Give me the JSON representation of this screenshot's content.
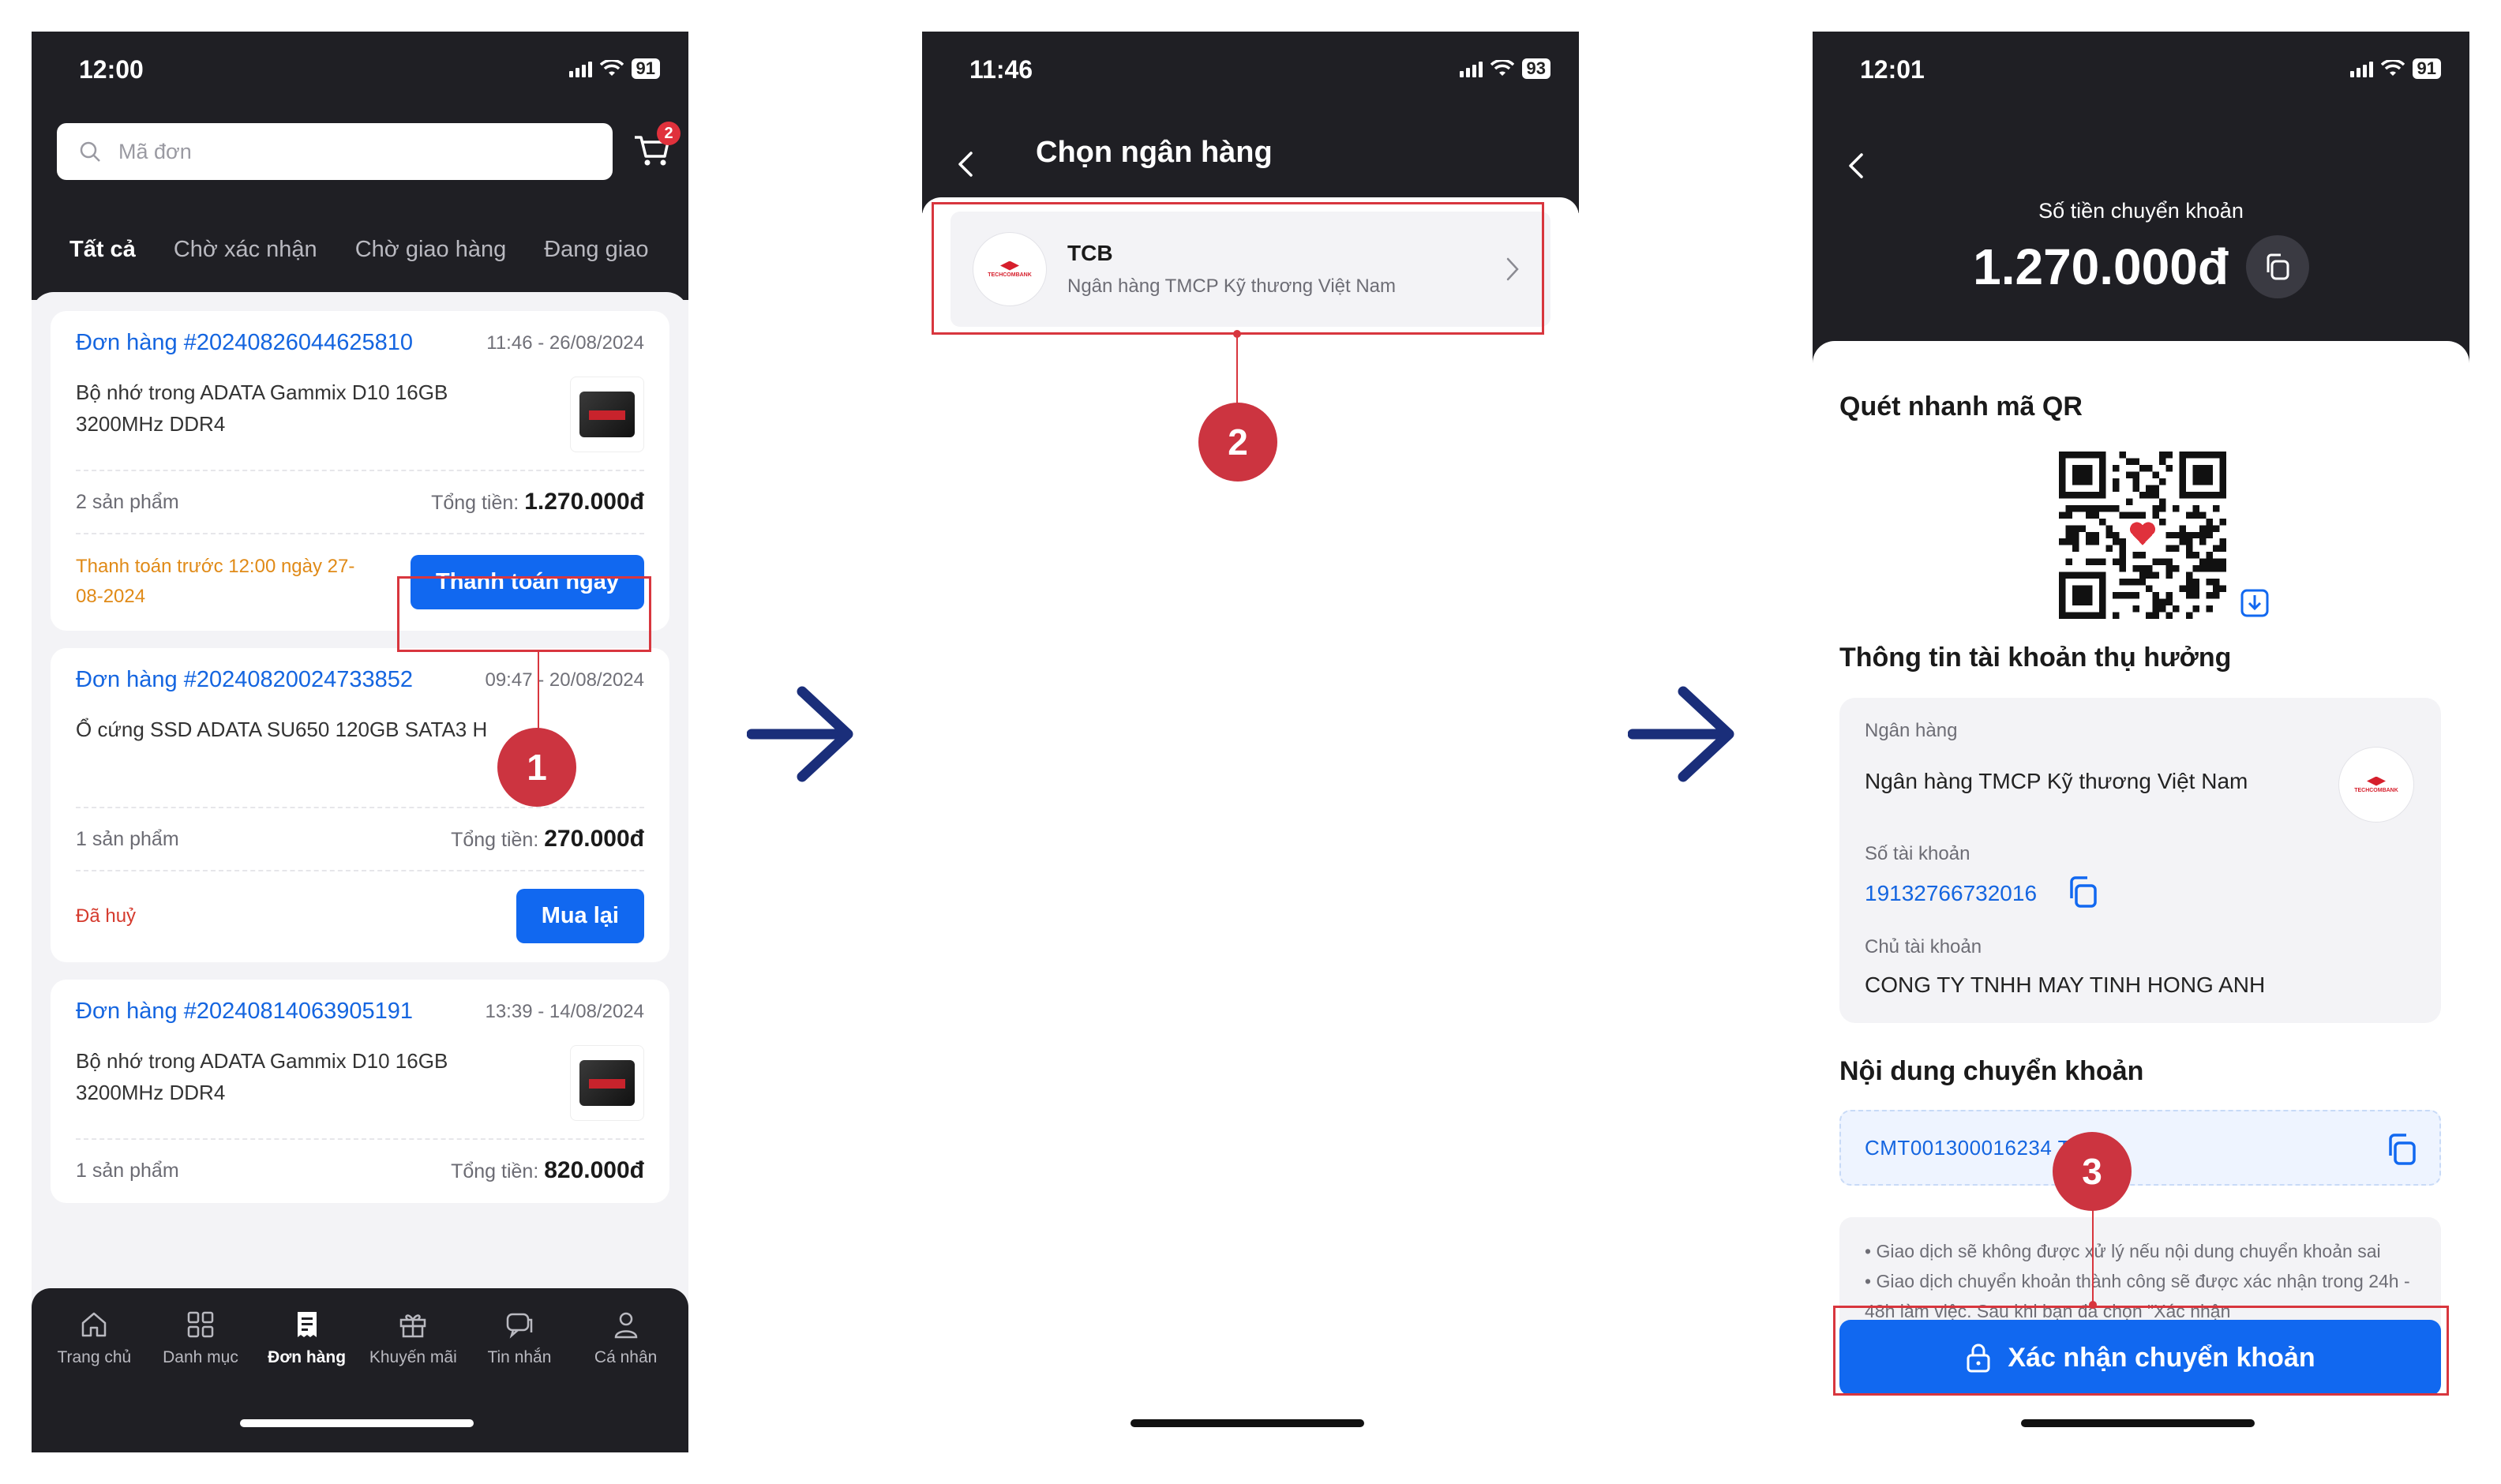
{
  "phone1": {
    "status_time": "12:00",
    "battery": "91",
    "search_placeholder": "Mã đơn",
    "cart_badge": "2",
    "tabs": [
      "Tất cả",
      "Chờ xác nhận",
      "Chờ giao hàng",
      "Đang giao"
    ],
    "orders": [
      {
        "id": "Đơn hàng #20240826044625810",
        "date": "11:46 - 26/08/2024",
        "product": "Bộ nhớ trong ADATA Gammix D10 16GB 3200MHz DDR4",
        "count": "2 sản phẩm",
        "total_label": "Tổng tiền:",
        "total": "1.270.000đ",
        "note": "Thanh toán trước 12:00 ngày 27-08-2024",
        "button": "Thanh toán ngay"
      },
      {
        "id": "Đơn hàng #20240820024733852",
        "date": "09:47 - 20/08/2024",
        "product": "Ổ cứng SSD ADATA SU650 120GB SATA3 H",
        "count": "1 sản phẩm",
        "total_label": "Tổng tiền:",
        "total": "270.000đ",
        "note": "Đã huỷ",
        "button": "Mua lại"
      },
      {
        "id": "Đơn hàng #20240814063905191",
        "date": "13:39 - 14/08/2024",
        "product": "Bộ nhớ trong ADATA Gammix D10 16GB 3200MHz DDR4",
        "count": "1 sản phẩm",
        "total_label": "Tổng tiền:",
        "total": "820.000đ"
      }
    ],
    "nav": [
      {
        "label": "Trang chủ",
        "icon": "home-icon"
      },
      {
        "label": "Danh mục",
        "icon": "grid-icon"
      },
      {
        "label": "Đơn hàng",
        "icon": "receipt-icon"
      },
      {
        "label": "Khuyến mãi",
        "icon": "gift-icon"
      },
      {
        "label": "Tin nhắn",
        "icon": "chat-icon"
      },
      {
        "label": "Cá nhân",
        "icon": "user-icon"
      }
    ]
  },
  "phone2": {
    "status_time": "11:46",
    "battery": "93",
    "title": "Chọn ngân hàng",
    "bank_code": "TCB",
    "bank_name": "Ngân hàng TMCP Kỹ thương Việt Nam"
  },
  "phone3": {
    "status_time": "12:01",
    "battery": "91",
    "amount_label": "Số tiền chuyển khoản",
    "amount": "1.270.000đ",
    "qr_title": "Quét nhanh mã QR",
    "beneficiary_title": "Thông tin tài khoản thụ hưởng",
    "bank_label": "Ngân hàng",
    "bank_value": "Ngân hàng TMCP Kỹ thương Việt Nam",
    "account_label": "Số tài khoản",
    "account_value": "19132766732016",
    "owner_label": "Chủ tài khoản",
    "owner_value": "CONG TY TNHH MAY TINH HONG ANH",
    "memo_title": "Nội dung chuyển khoản",
    "memo_value": "CMT001300016234 TTDH",
    "notes": [
      "• Giao dịch sẽ không được xử lý nếu nội dung chuyển khoản sai",
      "• Giao dịch chuyển khoản thành công sẽ được xác nhận trong 24h - 48h làm việc. Sau khi bạn đã chọn \"Xác nhận"
    ],
    "confirm_button": "Xác nhận chuyển khoản"
  },
  "steps": [
    "1",
    "2",
    "3"
  ],
  "colors": {
    "accent": "#1168f0",
    "dark": "#1f1f24",
    "annotation": "#d8363e",
    "arrow": "#1a2e7a"
  }
}
